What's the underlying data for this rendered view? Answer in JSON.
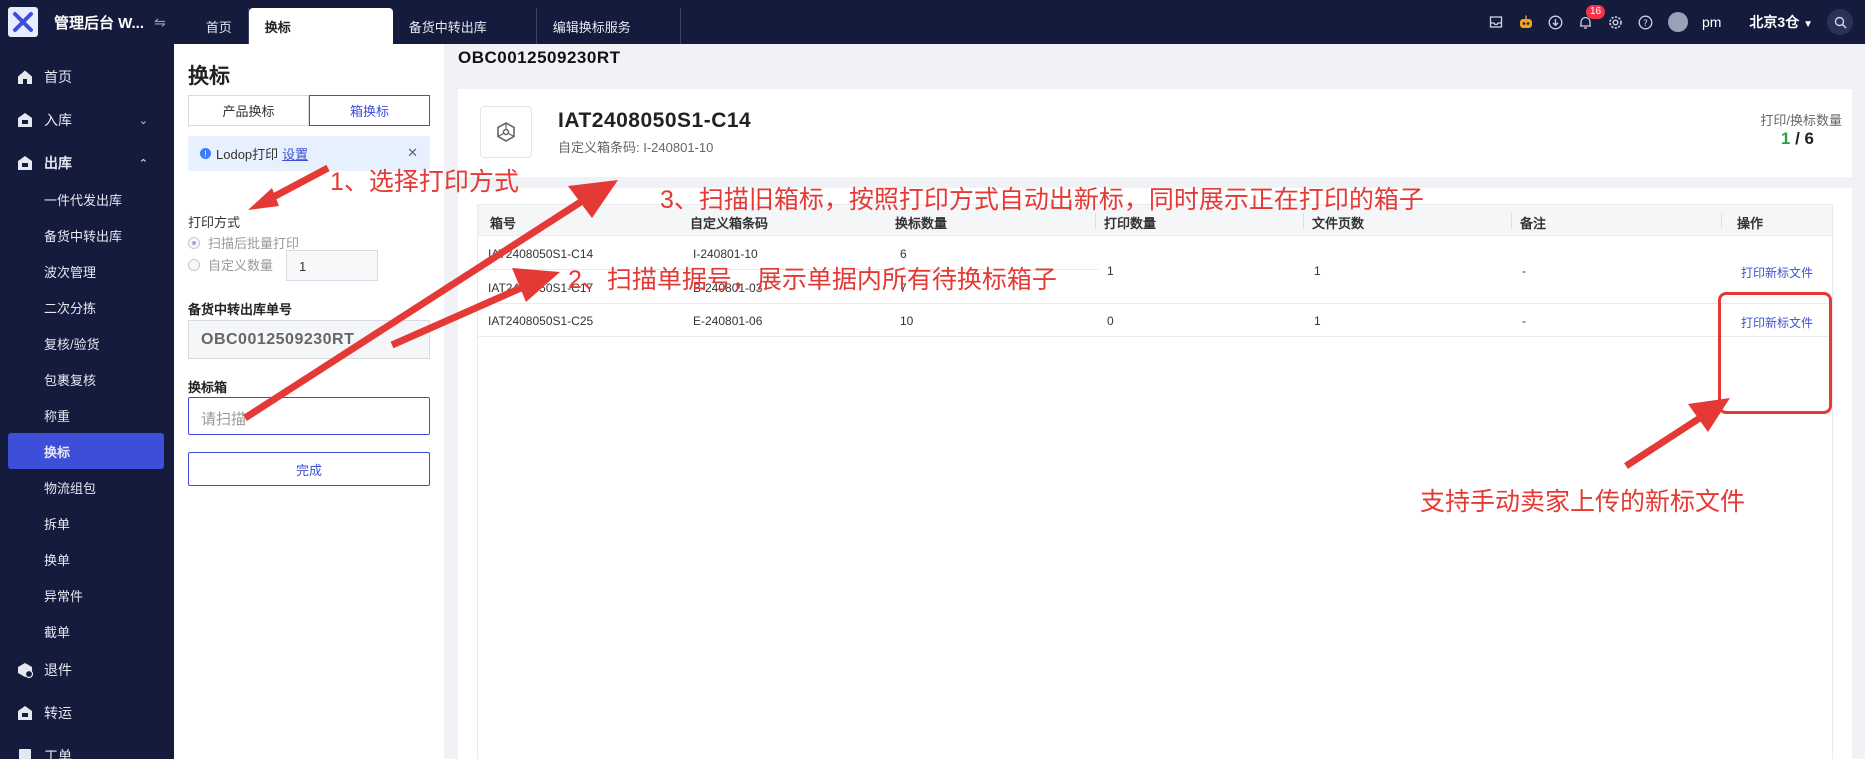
{
  "header": {
    "app_title": "管理后台 W...",
    "tabs": [
      {
        "label": "首页"
      },
      {
        "label": "换标"
      },
      {
        "label": "备货中转出库"
      },
      {
        "label": "编辑换标服务"
      }
    ],
    "notification_count": "16",
    "user_name": "pm",
    "warehouse": "北京3仓"
  },
  "sidebar": {
    "items": [
      {
        "label": "首页"
      },
      {
        "label": "入库"
      },
      {
        "label": "出库"
      },
      {
        "label": "退件"
      },
      {
        "label": "转运"
      },
      {
        "label": "工单"
      }
    ],
    "sub_items": [
      {
        "label": "一件代发出库"
      },
      {
        "label": "备货中转出库"
      },
      {
        "label": "波次管理"
      },
      {
        "label": "二次分拣"
      },
      {
        "label": "复核/验货"
      },
      {
        "label": "包裹复核"
      },
      {
        "label": "称重"
      },
      {
        "label": "换标"
      },
      {
        "label": "物流组包"
      },
      {
        "label": "拆单"
      },
      {
        "label": "换单"
      },
      {
        "label": "异常件"
      },
      {
        "label": "截单"
      }
    ]
  },
  "left_panel": {
    "title": "换标",
    "seg_product": "产品换标",
    "seg_box": "箱换标",
    "notice_text": "Lodop打印",
    "notice_link": "设置",
    "print_method_label": "打印方式",
    "radio_batch": "扫描后批量打印",
    "radio_custom": "自定义数量",
    "custom_qty_value": "1",
    "order_label": "备货中转出库单号",
    "order_value": "OBC0012509230RT",
    "scan_label": "换标箱",
    "scan_placeholder": "请扫描",
    "done_button": "完成"
  },
  "main": {
    "order_title": "OBC0012509230RT",
    "box_code": "IAT2408050S1-C14",
    "box_sub": "自定义箱条码: I-240801-10",
    "count_label": "打印/换标数量",
    "count_done": "1",
    "count_total": "/ 6"
  },
  "table": {
    "columns": [
      "箱号",
      "自定义箱条码",
      "换标数量",
      "打印数量",
      "文件页数",
      "备注",
      "操作"
    ],
    "rows": [
      {
        "box": "IAT2408050S1-C14",
        "custom": "I-240801-10",
        "qty": "6",
        "print": "1",
        "pages": "1",
        "remark": "-",
        "action": "打印新标文件"
      },
      {
        "box": "IAT2408050S1-C17",
        "custom": "B-240801-03",
        "qty": "7",
        "print": "",
        "pages": "",
        "remark": "",
        "action": ""
      },
      {
        "box": "IAT2408050S1-C25",
        "custom": "E-240801-06",
        "qty": "10",
        "print": "0",
        "pages": "1",
        "remark": "-",
        "action": "打印新标文件"
      }
    ]
  },
  "annotations": {
    "step1": "1、选择打印方式",
    "step2": "2、扫描单据号，展示单据内所有待换标箱子",
    "step3": "3、扫描旧箱标，按照打印方式自动出新标，同时展示正在打印的箱子",
    "note": "支持手动卖家上传的新标文件"
  },
  "colors": {
    "nav_bg": "#141b3d",
    "accent": "#3d4fd8",
    "annotation_red": "#e53935"
  }
}
